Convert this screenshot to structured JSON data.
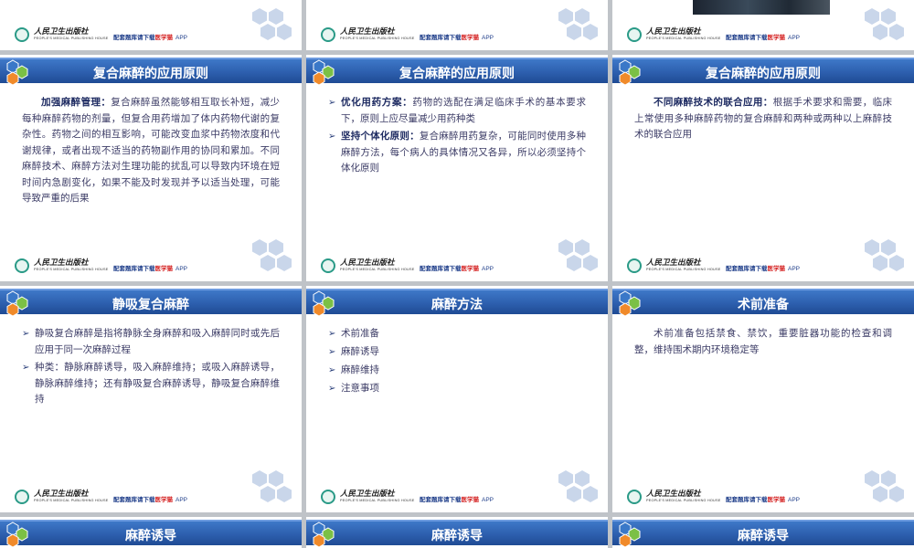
{
  "footer": {
    "publisher_cn": "人民卫生出版社",
    "publisher_en": "PEOPLE'S MEDICAL PUBLISHING HOUSE",
    "promo_prefix": "配套题库请下载",
    "promo_brand": "医学猫",
    "promo_app": "APP"
  },
  "colors": {
    "titlebar": "#2d5fae",
    "hex_light": "#c9d6ea",
    "corner_hex_blue": "#3a78c8",
    "corner_hex_orange": "#f08a2a",
    "corner_hex_green": "#7bc045"
  },
  "icons": [
    "hexagon-cluster-icon",
    "publisher-seal-icon",
    "arrow-bullet-icon"
  ],
  "slides": {
    "s1": {
      "title": "复合麻醉的应用原则",
      "bold": "加强麻醉管理：",
      "text": "复合麻醉虽然能够相互取长补短，减少每种麻醉药物的剂量，但复合用药增加了体内药物代谢的复杂性。药物之间的相互影响，可能改变血浆中药物浓度和代谢规律，或者出现不适当的药物副作用的协同和累加。不同麻醉技术、麻醉方法对生理功能的扰乱可以导致内环境在短时间内急剧变化，如果不能及时发现并予以适当处理，可能导致严重的后果"
    },
    "s2": {
      "title": "复合麻醉的应用原则",
      "items": [
        {
          "bold": "优化用药方案：",
          "text": "药物的选配在满足临床手术的基本要求下，原则上应尽量减少用药种类"
        },
        {
          "bold": "坚持个体化原则：",
          "text": "复合麻醉用药复杂，可能同时使用多种麻醉方法，每个病人的具体情况又各异，所以必须坚持个体化原则"
        }
      ]
    },
    "s3": {
      "title": "复合麻醉的应用原则",
      "bold": "不同麻醉技术的联合应用：",
      "text": "根据手术要求和需要，临床上常使用多种麻醉药物的复合麻醉和两种或两种以上麻醉技术的联合应用"
    },
    "s4": {
      "title": "静吸复合麻醉",
      "items": [
        {
          "text": "静吸复合麻醉是指将静脉全身麻醉和吸入麻醉同时或先后应用于同一次麻醉过程"
        },
        {
          "text": "种类：静脉麻醉诱导，吸入麻醉维持；或吸入麻醉诱导，静脉麻醉维持；还有静吸复合麻醉诱导，静吸复合麻醉维持"
        }
      ]
    },
    "s5": {
      "title": "麻醉方法",
      "items": [
        "术前准备",
        "麻醉诱导",
        "麻醉维持",
        "注意事项"
      ]
    },
    "s6": {
      "title": "术前准备",
      "text": "术前准备包括禁食、禁饮，重要脏器功能的检查和调整，维持围术期内环境稳定等"
    },
    "s7": {
      "title": "麻醉诱导"
    },
    "s8": {
      "title": "麻醉诱导"
    },
    "s9": {
      "title": "麻醉诱导"
    }
  }
}
